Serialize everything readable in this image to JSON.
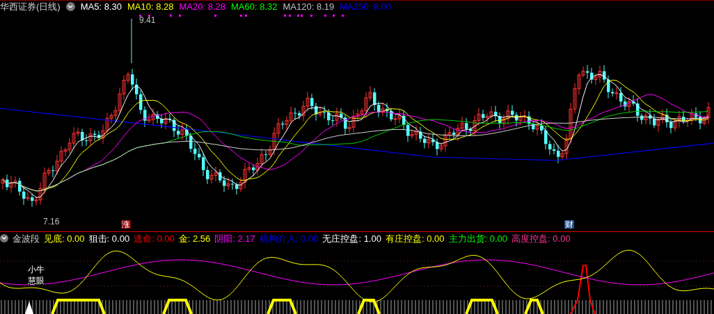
{
  "title": "华西证券(日线)",
  "ma_legend": [
    {
      "label": "MA5:",
      "value": "8.30",
      "color": "#ffffff"
    },
    {
      "label": "MA10:",
      "value": "8.28",
      "color": "#ffff00"
    },
    {
      "label": "MA20:",
      "value": "8.28",
      "color": "#ff00ff"
    },
    {
      "label": "MA60:",
      "value": "8.32",
      "color": "#00ff00"
    },
    {
      "label": "MA120:",
      "value": "8.19",
      "color": "#c0c0c0"
    },
    {
      "label": "MA250:",
      "value": "8.00",
      "color": "#0000ff"
    }
  ],
  "price_labels": {
    "high": "9.41",
    "low": "7.16"
  },
  "event_markers": [
    {
      "text": "涨",
      "color": "#8b0000"
    },
    {
      "text": "财",
      "color": "#1f4f8f"
    }
  ],
  "indicator": {
    "title": "金波段",
    "items": [
      {
        "label": "见底:",
        "value": "0.00",
        "color": "#ffff00"
      },
      {
        "label": "狙击:",
        "value": "0.00",
        "color": "#ffffff"
      },
      {
        "label": "逃命:",
        "value": "0.00",
        "color": "#ff0000"
      },
      {
        "label": "金:",
        "value": "2.56",
        "color": "#ffff00"
      },
      {
        "label": "阴阳:",
        "value": "2.17",
        "color": "#ff00ff"
      },
      {
        "label": "机构介入:",
        "value": "0.00",
        "color": "#0000ff"
      },
      {
        "label": "无庄控盘:",
        "value": "1.00",
        "color": "#ffffff"
      },
      {
        "label": "有庄控盘:",
        "value": "0.00",
        "color": "#ffff00"
      },
      {
        "label": "主力出货:",
        "value": "0.00",
        "color": "#00ff00"
      },
      {
        "label": "高度控盘:",
        "value": "0.00",
        "color": "#ff3399"
      }
    ]
  },
  "signal_labels": [
    "小牛",
    "慧眼"
  ]
}
